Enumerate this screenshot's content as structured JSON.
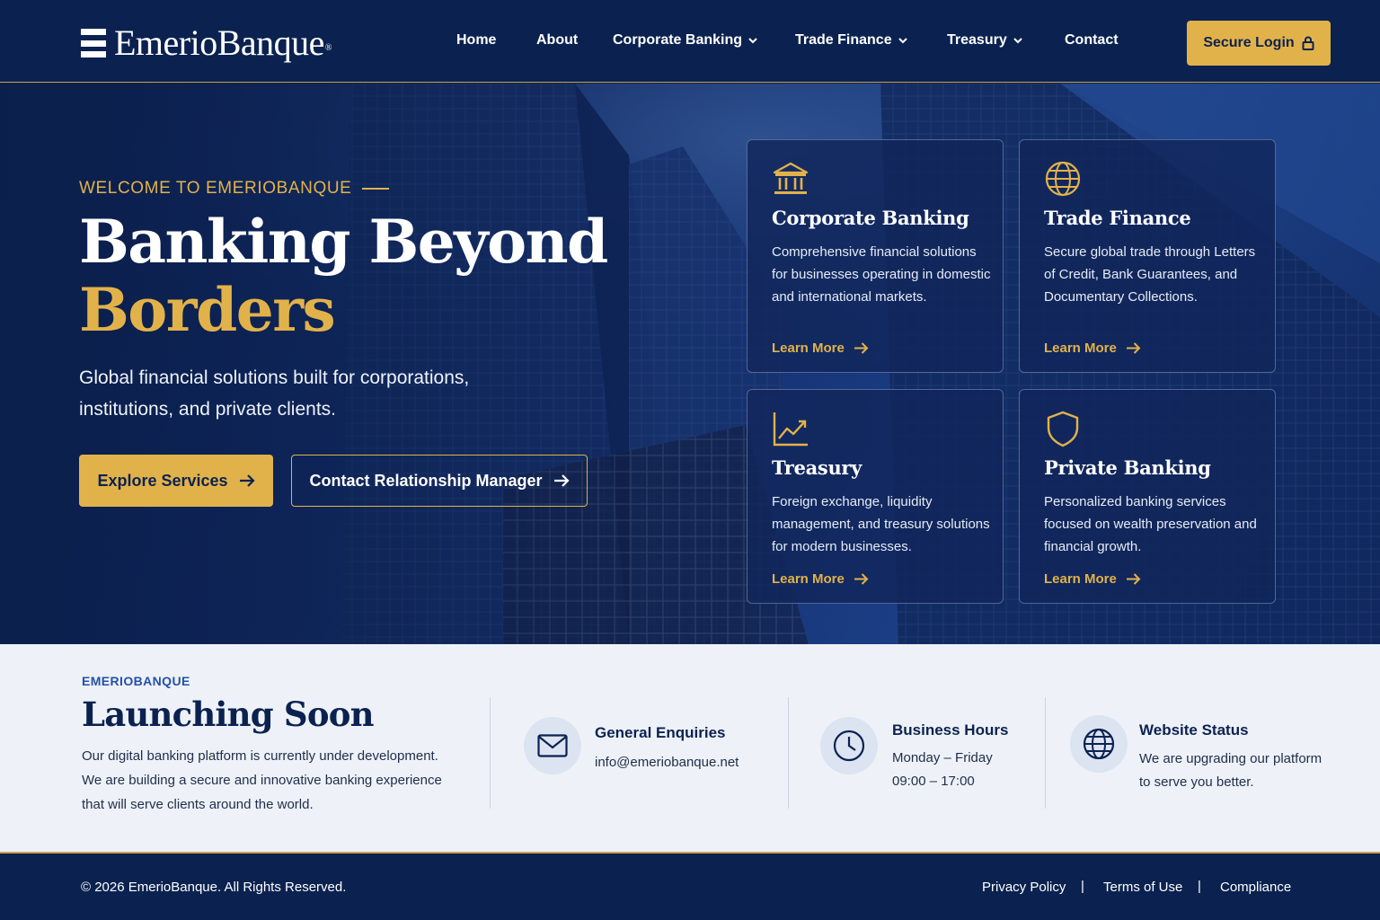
{
  "brand": {
    "name": "EmerioBanque",
    "mark": "®"
  },
  "nav": {
    "items": [
      {
        "label": "Home",
        "dropdown": false
      },
      {
        "label": "About",
        "dropdown": false
      },
      {
        "label": "Corporate Banking",
        "dropdown": true
      },
      {
        "label": "Trade Finance",
        "dropdown": true
      },
      {
        "label": "Treasury",
        "dropdown": true
      },
      {
        "label": "Contact",
        "dropdown": false
      }
    ],
    "login_label": "Secure Login"
  },
  "hero": {
    "eyebrow": "WELCOME TO EMERIOBANQUE",
    "title_line1": "Banking Beyond",
    "title_line2": "Borders",
    "subtitle": "Global financial solutions built for corporations, institutions, and private clients.",
    "primary_cta": "Explore Services",
    "secondary_cta": "Contact Relationship Manager"
  },
  "cards": [
    {
      "icon": "bank-building-icon",
      "title": "Corporate Banking",
      "text": "Comprehensive financial solutions for businesses operating in domestic and international markets.",
      "link": "Learn More"
    },
    {
      "icon": "globe-icon",
      "title": "Trade Finance",
      "text": "Secure global trade through Letters of Credit, Bank Guarantees, and Documentary Collections.",
      "link": "Learn More"
    },
    {
      "icon": "chart-line-icon",
      "title": "Treasury",
      "text": "Foreign exchange, liquidity management, and treasury solutions for modern businesses.",
      "link": "Learn More"
    },
    {
      "icon": "shield-icon",
      "title": "Private Banking",
      "text": "Personalized banking services focused on wealth preservation and financial growth.",
      "link": "Learn More"
    }
  ],
  "info": {
    "eyebrow": "EMERIOBANQUE",
    "title": "Launching Soon",
    "text": "Our digital banking platform is currently under development. We are building a secure and innovative banking experience that will serve clients around the world.",
    "enquiries": {
      "icon": "mail-icon",
      "title": "General Enquiries",
      "value": "info@emeriobanque.net"
    },
    "hours": {
      "icon": "clock-icon",
      "title": "Business Hours",
      "line1": "Monday – Friday",
      "line2": "09:00 – 17:00"
    },
    "status": {
      "icon": "globe-icon",
      "title": "Website Status",
      "line1": "We are upgrading our platform",
      "line2": "to serve you better."
    }
  },
  "footer": {
    "copyright": "© 2026 EmerioBanque. All Rights Reserved.",
    "links": [
      "Privacy Policy",
      "Terms of Use",
      "Compliance"
    ],
    "separator": "|"
  },
  "colors": {
    "navy": "#0b2250",
    "gold": "#e2b24a",
    "light": "#eef2f8"
  }
}
